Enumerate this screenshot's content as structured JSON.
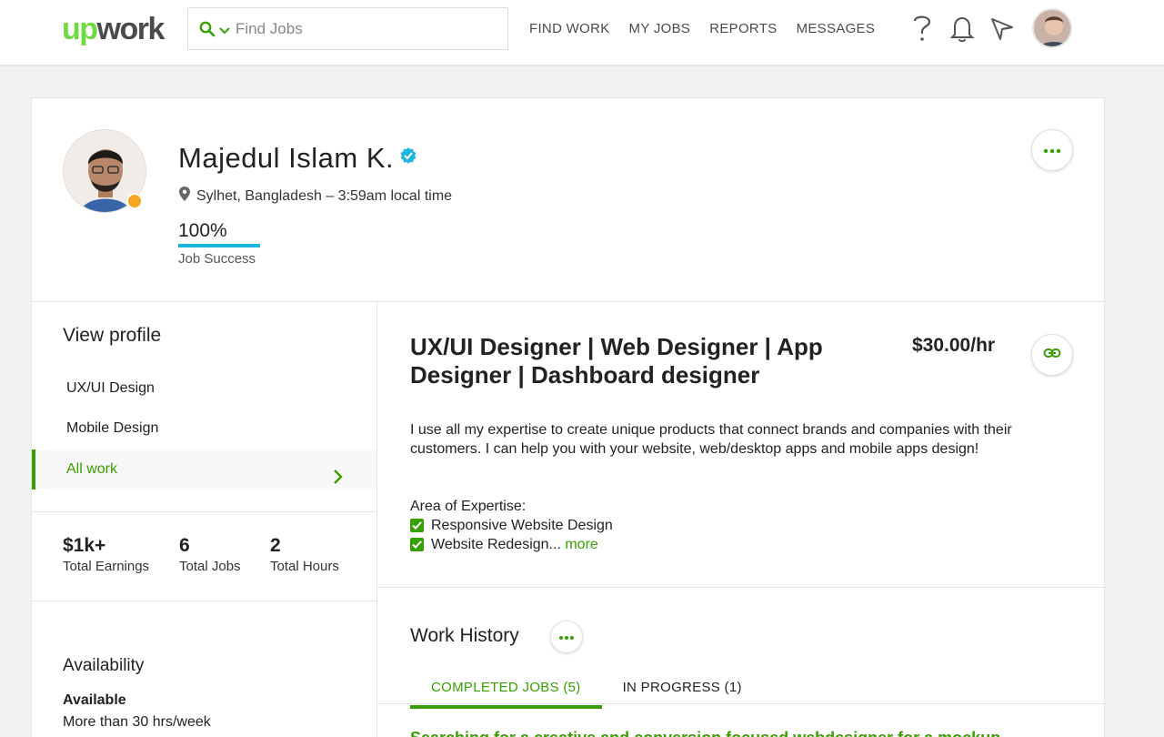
{
  "header": {
    "logo_up": "up",
    "logo_work": "work",
    "search_placeholder": "Find Jobs",
    "nav": [
      "FIND WORK",
      "MY JOBS",
      "REPORTS",
      "MESSAGES"
    ],
    "brand_color": "#6fda44"
  },
  "profile": {
    "name": "Majedul Islam K.",
    "location": "Sylhet, Bangladesh – 3:59am local time",
    "job_success_value": "100%",
    "job_success_label": "Job Success",
    "job_success_fraction": 1.0,
    "status_color": "#f6a623"
  },
  "sidebar": {
    "view_profile_title": "View profile",
    "items": [
      "UX/UI Design",
      "Mobile Design",
      "All work"
    ],
    "active_item": "All work",
    "stats": [
      {
        "value": "$1k+",
        "label": "Total Earnings"
      },
      {
        "value": "6",
        "label": "Total Jobs"
      },
      {
        "value": "2",
        "label": "Total Hours"
      }
    ],
    "availability_title": "Availability",
    "availability_value": "Available",
    "availability_detail": "More than 30 hrs/week"
  },
  "main": {
    "title": "UX/UI Designer | Web Designer | App Designer | Dashboard designer",
    "rate": "$30.00/hr",
    "description": "I use all my expertise to create unique products that connect brands and companies with their customers. I can help you with your website, web/desktop apps and mobile apps design!",
    "expertise_label": "Area of Expertise:",
    "expertise": [
      "Responsive Website Design",
      "Website Redesign..."
    ],
    "more_link": "more",
    "work_history_title": "Work History",
    "tabs": [
      "COMPLETED JOBS (5)",
      "IN PROGRESS (1)"
    ],
    "first_job": "Searching for a creative and conversion focused webdesigner for a mockup",
    "accent_color": "#37a000"
  }
}
